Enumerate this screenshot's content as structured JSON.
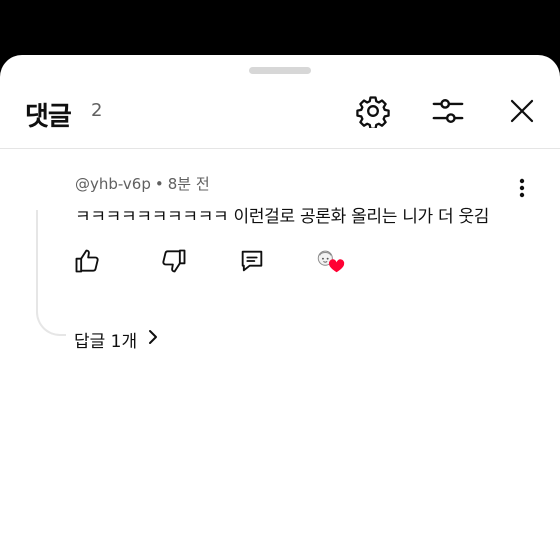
{
  "header": {
    "title": "댓글",
    "count": "2",
    "icons": [
      "gear-icon",
      "filter-sliders-icon",
      "close-icon"
    ]
  },
  "comment": {
    "author": "@yhb-v6p",
    "separator": "•",
    "time": "8분 전",
    "text": "ㅋㅋㅋㅋㅋㅋㅋㅋㅋㅋ 이런걸로 공론화 올리는 니가 더 웃김",
    "actions": [
      "thumbs-up-icon",
      "thumbs-down-icon",
      "reply-icon",
      "creator-heart-icon"
    ],
    "replies_label": "답글 1개"
  },
  "colors": {
    "background": "#ffffff",
    "text": "#0f0f0f",
    "secondary_text": "#606060",
    "heart": "#ff0033"
  }
}
